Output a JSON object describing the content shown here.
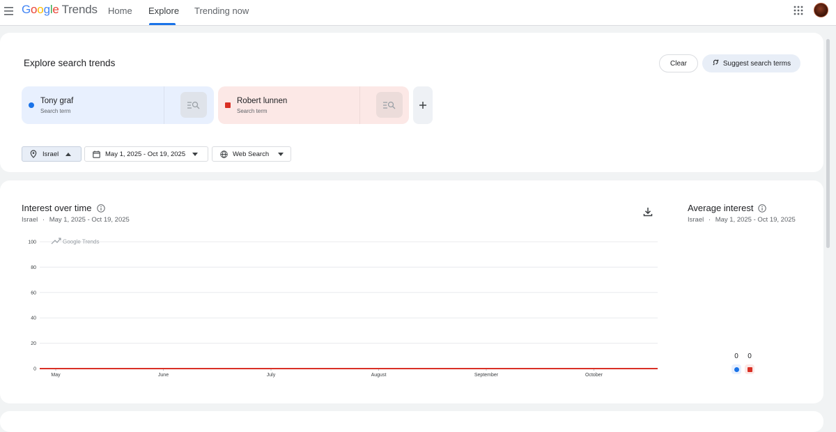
{
  "header": {
    "logo_letters": [
      "G",
      "o",
      "o",
      "g",
      "l",
      "e"
    ],
    "logo_product": "Trends",
    "nav": [
      {
        "label": "Home",
        "active": false
      },
      {
        "label": "Explore",
        "active": true
      },
      {
        "label": "Trending now",
        "active": false
      }
    ],
    "icons": {
      "menu": "hamburger-menu-icon",
      "apps": "apps-grid-icon",
      "avatar": "user-avatar"
    }
  },
  "explore": {
    "title": "Explore search trends",
    "clear_label": "Clear",
    "suggest_label": "Suggest search terms",
    "terms": [
      {
        "name": "Tony graf",
        "subtitle": "Search term",
        "color": "#1a73e8"
      },
      {
        "name": "Robert lunnen",
        "subtitle": "Search term",
        "color": "#d93025"
      }
    ],
    "filters": {
      "geo": "Israel",
      "date_range": "May 1, 2025 - Oct 19, 2025",
      "search_type": "Web Search"
    }
  },
  "interest_over_time": {
    "title": "Interest over time",
    "subtitle_geo": "Israel",
    "subtitle_sep": "·",
    "subtitle_range": "May 1, 2025 - Oct 19, 2025",
    "watermark": "Google Trends"
  },
  "average_interest": {
    "title": "Average interest",
    "subtitle_geo": "Israel",
    "subtitle_sep": "·",
    "subtitle_range": "May 1, 2025 - Oct 19, 2025",
    "values": [
      "0",
      "0"
    ]
  },
  "chart_data": {
    "type": "line",
    "title": "",
    "xlabel": "",
    "ylabel": "",
    "yticks": [
      "100",
      "80",
      "60",
      "40",
      "20",
      "0"
    ],
    "ylim": [
      0,
      100
    ],
    "xticks": [
      "May",
      "June",
      "July",
      "August",
      "September",
      "October"
    ],
    "grid": true,
    "series": [
      {
        "name": "Tony graf",
        "color": "#1a73e8",
        "values": [
          0,
          0,
          0,
          0,
          0,
          0,
          0
        ]
      },
      {
        "name": "Robert lunnen",
        "color": "#d93025",
        "values": [
          0,
          0,
          0,
          0,
          0,
          0,
          0
        ]
      }
    ]
  }
}
